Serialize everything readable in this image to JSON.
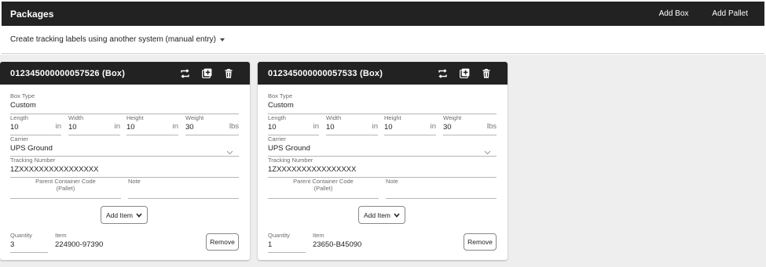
{
  "header": {
    "title": "Packages",
    "add_box": "Add Box",
    "add_pallet": "Add Pallet"
  },
  "tracking": {
    "prefix": "Create tracking labels using",
    "selected": "another system (manual entry)"
  },
  "cards": [
    {
      "title": "012345000000057526 (Box)",
      "box_type": {
        "label": "Box Type",
        "value": "Custom"
      },
      "length": {
        "label": "Length",
        "value": "10",
        "unit": "in"
      },
      "width": {
        "label": "Width",
        "value": "10",
        "unit": "in"
      },
      "height": {
        "label": "Height",
        "value": "10",
        "unit": "in"
      },
      "weight": {
        "label": "Weight",
        "value": "30",
        "unit": "lbs"
      },
      "carrier": {
        "label": "Carrier",
        "value": "UPS Ground"
      },
      "tracking_number": {
        "label": "Tracking Number",
        "value": "1ZXXXXXXXXXXXXXXXX"
      },
      "parent_code": {
        "label_line1": "Parent Container Code",
        "label_line2": "(Pallet)",
        "value": ""
      },
      "note": {
        "label": "Note",
        "value": ""
      },
      "add_item": "Add Item",
      "quantity": {
        "label": "Quantity",
        "value": "3"
      },
      "item": {
        "label": "Item",
        "value": "224900-97390"
      },
      "remove": "Remove"
    },
    {
      "title": "012345000000057533 (Box)",
      "box_type": {
        "label": "Box Type",
        "value": "Custom"
      },
      "length": {
        "label": "Length",
        "value": "10",
        "unit": "in"
      },
      "width": {
        "label": "Width",
        "value": "10",
        "unit": "in"
      },
      "height": {
        "label": "Height",
        "value": "10",
        "unit": "in"
      },
      "weight": {
        "label": "Weight",
        "value": "30",
        "unit": "lbs"
      },
      "carrier": {
        "label": "Carrier",
        "value": "UPS Ground"
      },
      "tracking_number": {
        "label": "Tracking Number",
        "value": "1ZXXXXXXXXXXXXXXXX"
      },
      "parent_code": {
        "label_line1": "Parent Container Code",
        "label_line2": "(Pallet)",
        "value": ""
      },
      "note": {
        "label": "Note",
        "value": ""
      },
      "add_item": "Add Item",
      "quantity": {
        "label": "Quantity",
        "value": "1"
      },
      "item": {
        "label": "Item",
        "value": "23650-B45090"
      },
      "remove": "Remove"
    }
  ]
}
